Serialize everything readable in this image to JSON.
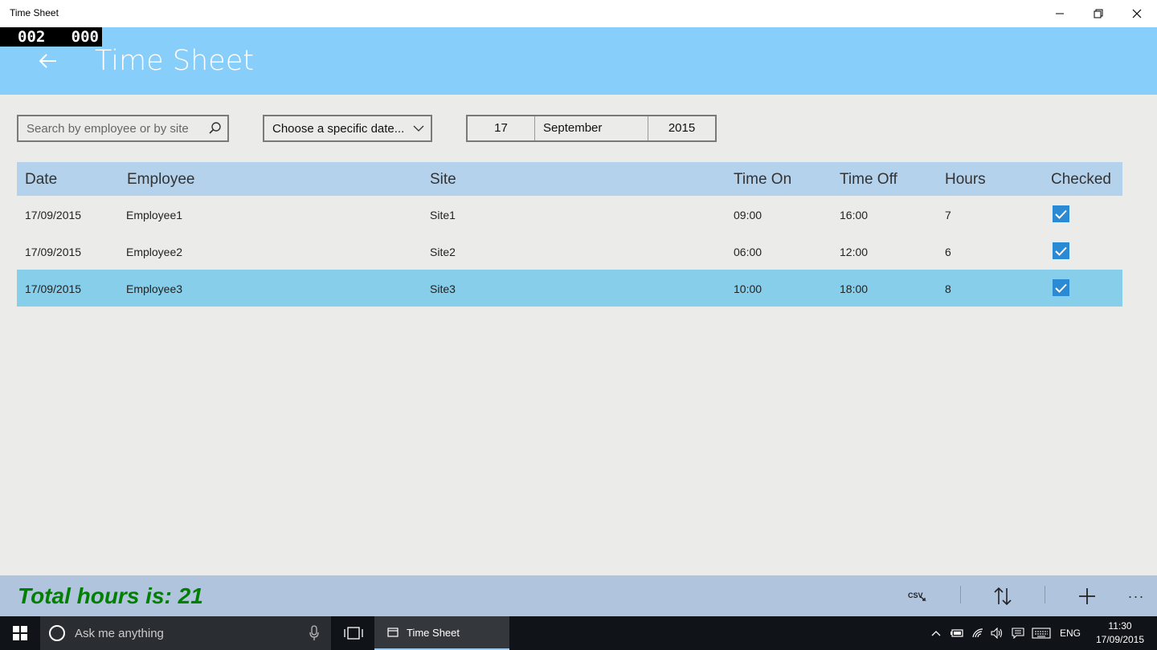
{
  "window": {
    "title": "Time Sheet",
    "minimize_glyph": "—",
    "maximize_glyph": "❐",
    "close_glyph": "✕"
  },
  "header": {
    "counter_left": "002",
    "counter_right": "000",
    "title": "Time Sheet",
    "background": "#87cefa"
  },
  "search": {
    "placeholder": "Search by employee or by site",
    "value": "",
    "icon": "search-icon"
  },
  "date_filter": {
    "selected": "Choose a specific date..."
  },
  "date_picker": {
    "day": "17",
    "month": "September",
    "year": "2015"
  },
  "table": {
    "columns": [
      "Date",
      "Employee",
      "Site",
      "Time On",
      "Time Off",
      "Hours",
      "Checked"
    ],
    "rows": [
      {
        "date": "17/09/2015",
        "employee": "Employee1",
        "site": "Site1",
        "time_on": "09:00",
        "time_off": "16:00",
        "hours": "7",
        "checked": true,
        "selected": false
      },
      {
        "date": "17/09/2015",
        "employee": "Employee2",
        "site": "Site2",
        "time_on": "06:00",
        "time_off": "12:00",
        "hours": "6",
        "checked": true,
        "selected": false
      },
      {
        "date": "17/09/2015",
        "employee": "Employee3",
        "site": "Site3",
        "time_on": "10:00",
        "time_off": "18:00",
        "hours": "8",
        "checked": true,
        "selected": true
      }
    ],
    "header_color": "#b4d2eb",
    "selected_color": "#87ceea",
    "checkbox_color": "#2a8ad4"
  },
  "appbar": {
    "total_label": "Total hours is: 21",
    "total_color": "#008000",
    "csv_label": "CSV",
    "more_label": "···"
  },
  "taskbar": {
    "search_placeholder": "Ask me anything",
    "app_label": "Time Sheet",
    "language": "ENG",
    "time": "11:30",
    "date": "17/09/2015"
  }
}
